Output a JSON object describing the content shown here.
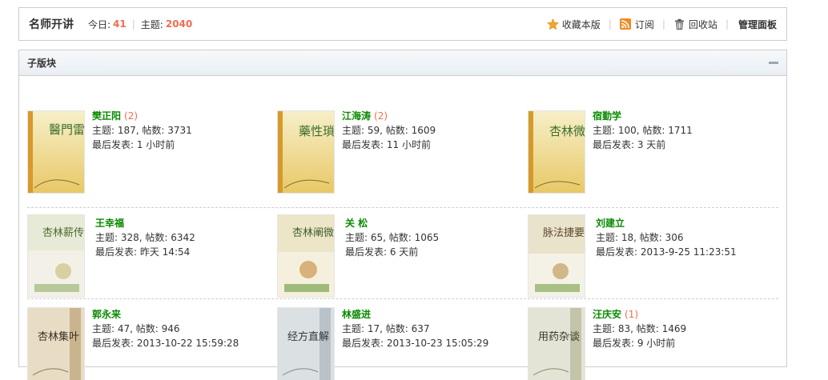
{
  "header": {
    "title": "名师开讲",
    "today_label": "今日:",
    "today_value": "41",
    "topics_label": "主题:",
    "topics_value": "2040",
    "favorite_label": "收藏本版",
    "rss_label": "订阅",
    "recycle_label": "回收站",
    "manage_label": "管理面板"
  },
  "panel": {
    "title": "子版块"
  },
  "subforums": [
    {
      "name": "樊正阳",
      "today": "(2)",
      "stats": "主题: 187, 帖数: 3731",
      "last": "最后发表: 1 小时前"
    },
    {
      "name": "江海涛",
      "today": "(2)",
      "stats": "主题: 59, 帖数: 1609",
      "last": "最后发表: 11 小时前"
    },
    {
      "name": "宿勤学",
      "today": "",
      "stats": "主题: 100, 帖数: 1711",
      "last": "最后发表: 3 天前"
    },
    {
      "name": "王幸福",
      "today": "",
      "stats": "主题: 328, 帖数: 6342",
      "last": "最后发表: 昨天 14:54"
    },
    {
      "name": "关 松",
      "today": "",
      "stats": "主题: 65, 帖数: 1065",
      "last": "最后发表: 6 天前"
    },
    {
      "name": "刘建立",
      "today": "",
      "stats": "主题: 18, 帖数: 306",
      "last": "最后发表: 2013-9-25 11:23:51"
    },
    {
      "name": "郭永来",
      "today": "",
      "stats": "主题: 47, 帖数: 946",
      "last": "最后发表: 2013-10-22 15:59:28"
    },
    {
      "name": "林盛进",
      "today": "",
      "stats": "主题: 17, 帖数: 637",
      "last": "最后发表: 2013-10-23 15:05:29"
    },
    {
      "name": "汪庆安",
      "today": "(1)",
      "stats": "主题: 83, 帖数: 1469",
      "last": "最后发表: 9 小时前"
    }
  ],
  "covers": [
    {
      "text": "醫門雷眼"
    },
    {
      "text": "藥性瑣談"
    },
    {
      "text": "杏林微探"
    },
    {
      "text": "杏林薪传"
    },
    {
      "text": "杏林阐微"
    },
    {
      "text": "脉法捷要"
    },
    {
      "text": "杏林集叶"
    },
    {
      "text": "经方直解"
    },
    {
      "text": "用药杂谈"
    }
  ],
  "colors": {
    "accent": "#f26c4f",
    "forum_name": "#0a8a00",
    "border": "#cdcdcd"
  }
}
